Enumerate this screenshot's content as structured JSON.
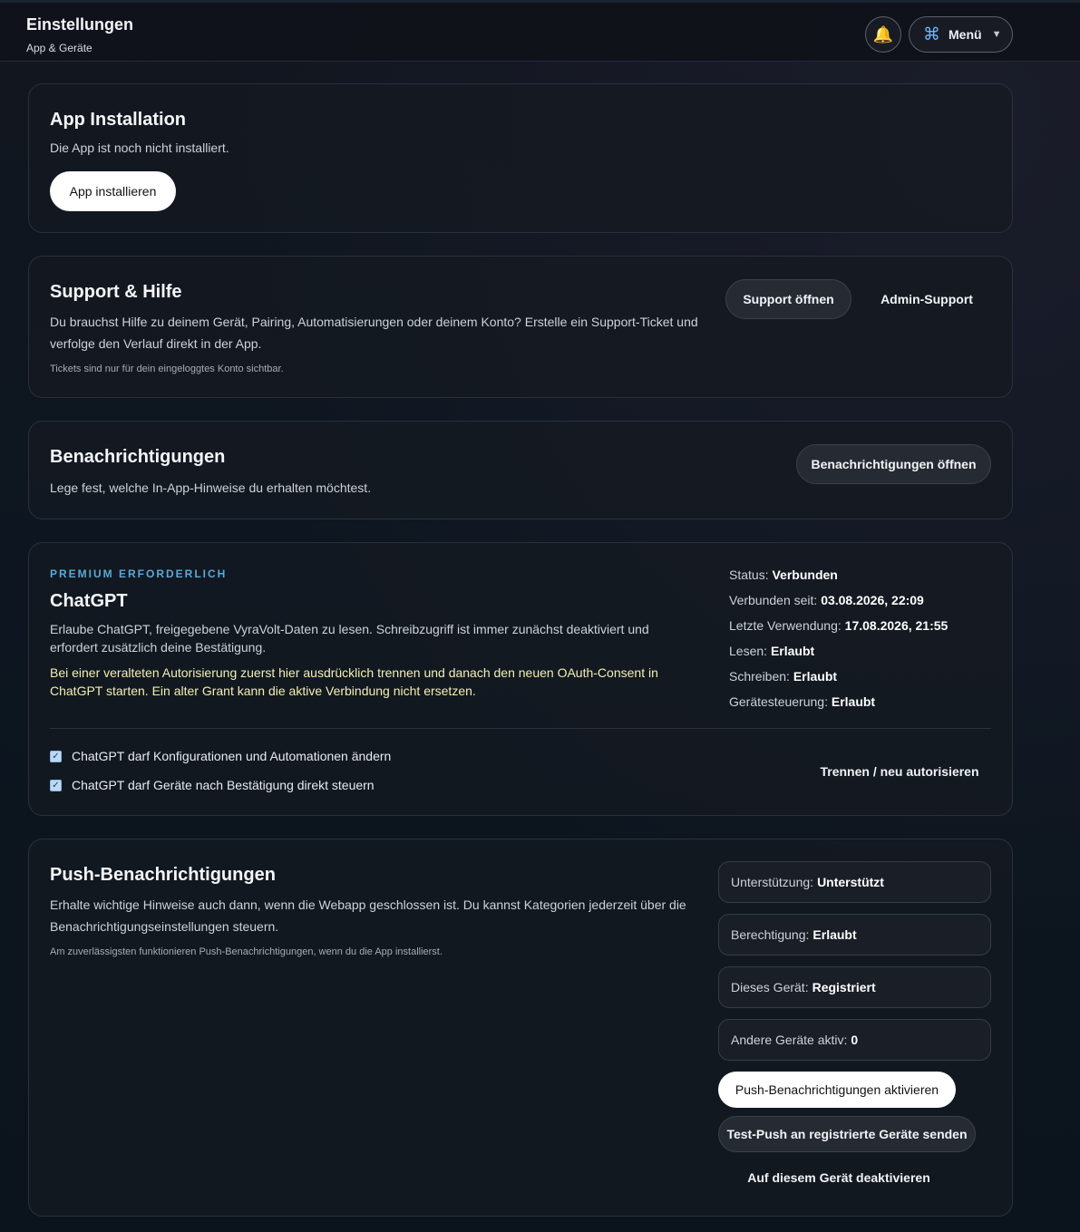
{
  "header": {
    "title": "Einstellungen",
    "subtitle": "App & Geräte",
    "bell_icon": "🔔",
    "menu_icon": "⌘",
    "menu_label": "Menü",
    "menu_caret": "▼"
  },
  "app_install": {
    "title": "App Installation",
    "description": "Die App ist noch nicht installiert.",
    "install_button": "App installieren"
  },
  "support": {
    "title": "Support & Hilfe",
    "description": "Du brauchst Hilfe zu deinem Gerät, Pairing, Automatisierungen oder deinem Konto? Erstelle ein Support-Ticket und verfolge den Verlauf direkt in der App.",
    "note": "Tickets sind nur für dein eingeloggtes Konto sichtbar.",
    "open_button": "Support öffnen",
    "admin_button": "Admin-Support"
  },
  "notifications": {
    "title": "Benachrichtigungen",
    "description": "Lege fest, welche In-App-Hinweise du erhalten möchtest.",
    "open_button": "Benachrichtigungen öffnen"
  },
  "chatgpt": {
    "eyebrow": "PREMIUM ERFORDERLICH",
    "title": "ChatGPT",
    "description": "Erlaube ChatGPT, freigegebene VyraVolt-Daten zu lesen. Schreibzugriff ist immer zunächst deaktiviert und erfordert zusätzlich deine Bestätigung.",
    "warning": "Bei einer veralteten Autorisierung zuerst hier ausdrücklich trennen und danach den neuen OAuth-Consent in ChatGPT starten. Ein alter Grant kann die aktive Verbindung nicht ersetzen.",
    "status": [
      {
        "label": "Status:",
        "value": "Verbunden"
      },
      {
        "label": "Verbunden seit:",
        "value": "03.08.2026, 22:09"
      },
      {
        "label": "Letzte Verwendung:",
        "value": "17.08.2026, 21:55"
      },
      {
        "label": "Lesen:",
        "value": "Erlaubt"
      },
      {
        "label": "Schreiben:",
        "value": "Erlaubt"
      },
      {
        "label": "Gerätesteuerung:",
        "value": "Erlaubt"
      }
    ],
    "checkboxes": [
      {
        "label": "ChatGPT darf Konfigurationen und Automationen ändern",
        "checked": true
      },
      {
        "label": "ChatGPT darf Geräte nach Bestätigung direkt steuern",
        "checked": true
      }
    ],
    "disconnect_button": "Trennen / neu autorisieren"
  },
  "push": {
    "title": "Push-Benachrichtigungen",
    "description": "Erhalte wichtige Hinweise auch dann, wenn die Webapp geschlossen ist. Du kannst Kategorien jederzeit über die Benachrichtigungseinstellungen steuern.",
    "note": "Am zuverlässigsten funktionieren Push-Benachrichtigungen, wenn du die App installierst.",
    "status": [
      {
        "label": "Unterstützung:",
        "value": "Unterstützt"
      },
      {
        "label": "Berechtigung:",
        "value": "Erlaubt"
      },
      {
        "label": "Dieses Gerät:",
        "value": "Registriert"
      },
      {
        "label": "Andere Geräte aktiv:",
        "value": "0"
      }
    ],
    "activate_button": "Push-Benachrichtigungen aktivieren",
    "test_button": "Test-Push an registrierte Geräte senden",
    "deactivate_button": "Auf diesem Gerät deaktivieren"
  }
}
